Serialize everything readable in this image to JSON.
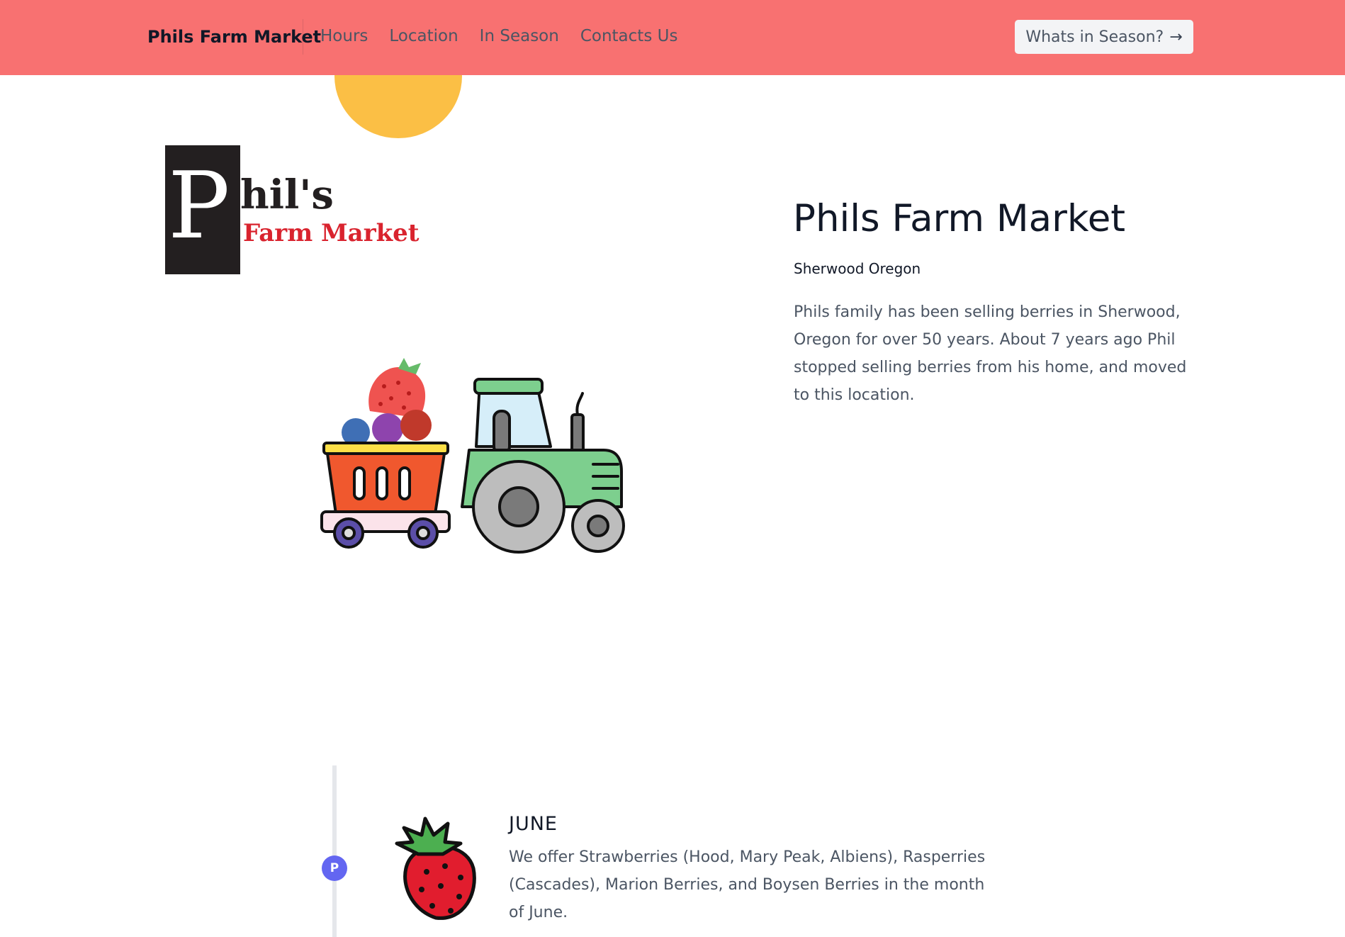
{
  "nav": {
    "brand": "Phils Farm Market",
    "links": [
      "Hours",
      "Location",
      "In Season",
      "Contacts Us"
    ],
    "cta_label": "Whats in Season?",
    "cta_icon": "arrow-right-icon"
  },
  "logo": {
    "letter": "P",
    "rest": "hil's",
    "subtitle": "Farm Market"
  },
  "hero": {
    "title": "Phils Farm Market",
    "subtitle": "Sherwood Oregon",
    "description": "Phils family has been selling berries in Sherwood, Oregon for over 50 years. About 7 years ago Phil stopped selling berries from his home, and moved to this location."
  },
  "timeline": {
    "entries": [
      {
        "marker": "P",
        "icon": "strawberry-icon",
        "title": "JUNE",
        "description": "We offer Strawberries (Hood, Mary Peak, Albiens), Rasperries (Cascades), Marion Berries, and Boysen Berries in the month of June."
      }
    ]
  },
  "colors": {
    "header_bg": "#f87171",
    "sun": "#fbbf45",
    "timeline_marker": "#6366f1",
    "logo_red": "#d9232e"
  }
}
